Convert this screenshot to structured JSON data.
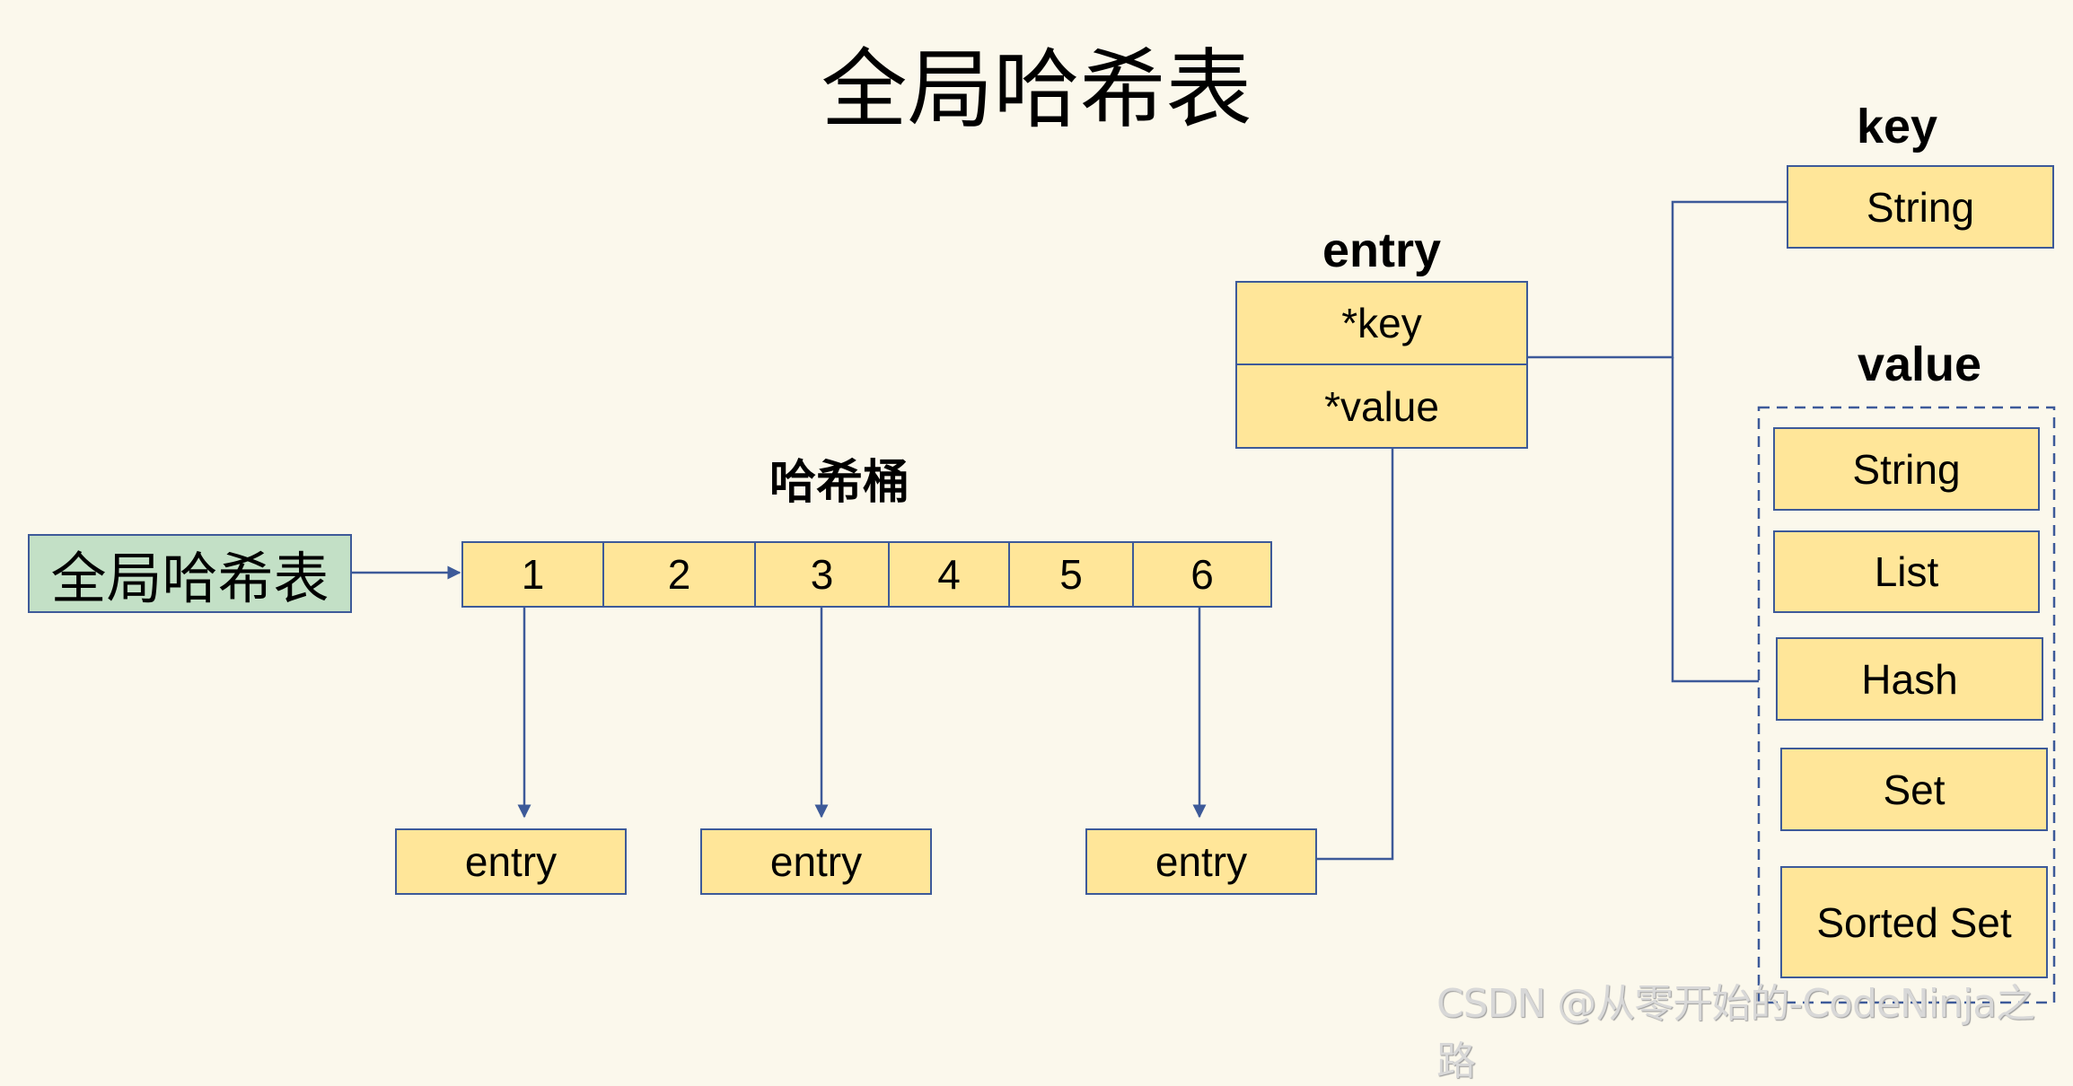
{
  "title": "全局哈希表",
  "global_table": {
    "label": "全局哈希表"
  },
  "buckets": {
    "label": "哈希桶",
    "cells": [
      "1",
      "2",
      "3",
      "4",
      "5",
      "6"
    ]
  },
  "bucket_entries": [
    {
      "bucket": "1",
      "label": "entry"
    },
    {
      "bucket": "3",
      "label": "entry"
    },
    {
      "bucket": "6",
      "label": "entry"
    }
  ],
  "entry_struct": {
    "label": "entry",
    "fields": [
      "*key",
      "*value"
    ]
  },
  "key": {
    "label": "key",
    "types": [
      "String"
    ]
  },
  "value": {
    "label": "value",
    "types": [
      "String",
      "List",
      "Hash",
      "Set",
      "Sorted Set"
    ]
  },
  "colors": {
    "background": "#FBF8EC",
    "box_fill": "#FFE699",
    "global_fill": "#C3E0C6",
    "border": "#3D5A99"
  },
  "watermark": "CSDN @从零开始的-CodeNinja之路"
}
